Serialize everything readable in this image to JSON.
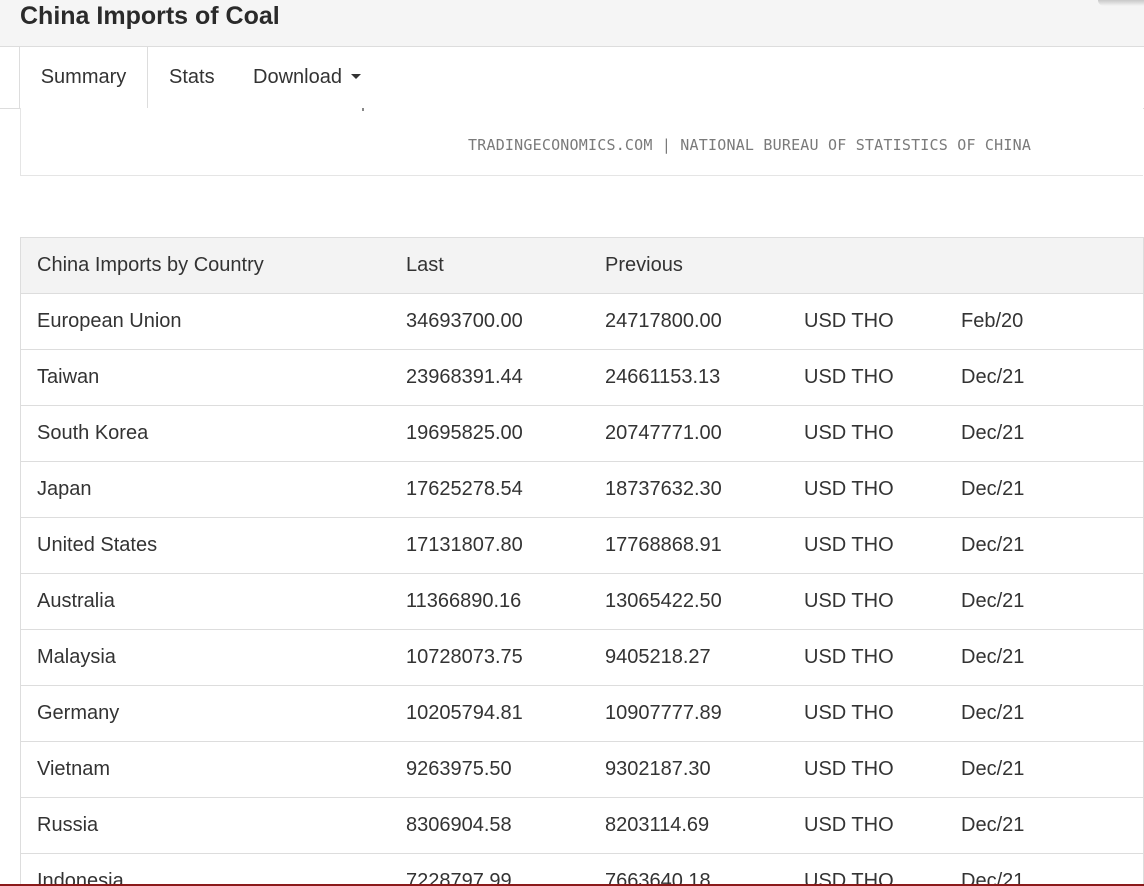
{
  "page": {
    "title": "China Imports of Coal"
  },
  "tabs": [
    {
      "label": "Summary",
      "active": true
    },
    {
      "label": "Stats",
      "active": false
    },
    {
      "label": "Download",
      "active": false,
      "has_dropdown": true
    }
  ],
  "chart_box": {
    "source_text": "TRADINGECONOMICS.COM | NATIONAL BUREAU OF STATISTICS OF CHINA"
  },
  "table": {
    "headers": [
      "China Imports by Country",
      "Last",
      "Previous",
      "",
      ""
    ],
    "rows": [
      {
        "country": "European Union",
        "last": "34693700.00",
        "previous": "24717800.00",
        "unit": "USD THO",
        "date": "Feb/20"
      },
      {
        "country": "Taiwan",
        "last": "23968391.44",
        "previous": "24661153.13",
        "unit": "USD THO",
        "date": "Dec/21"
      },
      {
        "country": "South Korea",
        "last": "19695825.00",
        "previous": "20747771.00",
        "unit": "USD THO",
        "date": "Dec/21"
      },
      {
        "country": "Japan",
        "last": "17625278.54",
        "previous": "18737632.30",
        "unit": "USD THO",
        "date": "Dec/21"
      },
      {
        "country": "United States",
        "last": "17131807.80",
        "previous": "17768868.91",
        "unit": "USD THO",
        "date": "Dec/21"
      },
      {
        "country": "Australia",
        "last": "11366890.16",
        "previous": "13065422.50",
        "unit": "USD THO",
        "date": "Dec/21"
      },
      {
        "country": "Malaysia",
        "last": "10728073.75",
        "previous": "9405218.27",
        "unit": "USD THO",
        "date": "Dec/21"
      },
      {
        "country": "Germany",
        "last": "10205794.81",
        "previous": "10907777.89",
        "unit": "USD THO",
        "date": "Dec/21"
      },
      {
        "country": "Vietnam",
        "last": "9263975.50",
        "previous": "9302187.30",
        "unit": "USD THO",
        "date": "Dec/21"
      },
      {
        "country": "Russia",
        "last": "8306904.58",
        "previous": "8203114.69",
        "unit": "USD THO",
        "date": "Dec/21"
      },
      {
        "country": "Indonesia",
        "last": "7228797.99",
        "previous": "7663640.18",
        "unit": "USD THO",
        "date": "Dec/21"
      }
    ]
  },
  "colors": {
    "bottom_accent": "#8b1a1a",
    "header_bg": "#f3f3f3",
    "title_bar_bg": "#f5f5f5"
  }
}
